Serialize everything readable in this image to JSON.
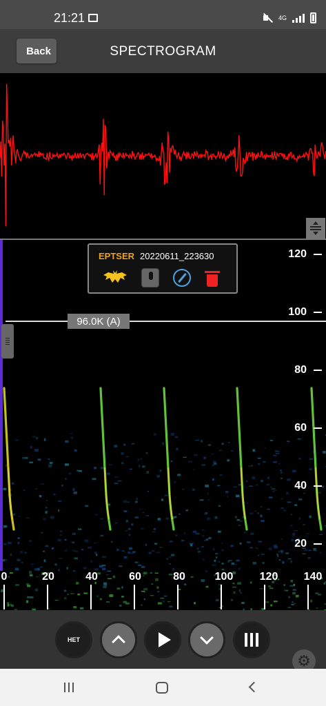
{
  "status": {
    "time": "21:21",
    "network": "4G"
  },
  "header": {
    "back_label": "Back",
    "title": "SPECTROGRAM"
  },
  "recording": {
    "species": "EPTSER",
    "file_id": "20220611_223630"
  },
  "marker": {
    "label": "96.0K (A)",
    "value_khz": 96
  },
  "spectrogram": {
    "y_axis": {
      "ticks": [
        "20",
        "40",
        "60",
        "80",
        "100",
        "120"
      ]
    },
    "x_axis": {
      "ticks": [
        "0",
        "20",
        "40",
        "60",
        "80",
        "100",
        "120",
        "140"
      ]
    }
  },
  "controls": {
    "het_label": "HET"
  },
  "icons": [
    "image-icon",
    "mute-icon",
    "signal-icon",
    "battery-icon",
    "bat-icon",
    "microphone-icon",
    "compass-icon",
    "trash-icon",
    "het-icon",
    "chevron-up-icon",
    "play-icon",
    "chevron-down-icon",
    "menu-bars-icon",
    "gear-icon",
    "resize-icon",
    "recents-icon",
    "home-icon",
    "back-icon"
  ],
  "colors": {
    "waveform": "#ff1010",
    "species": "#f0a020",
    "compass": "#4aa3df",
    "trash": "#e22222",
    "accent": "#5b2bd6"
  }
}
